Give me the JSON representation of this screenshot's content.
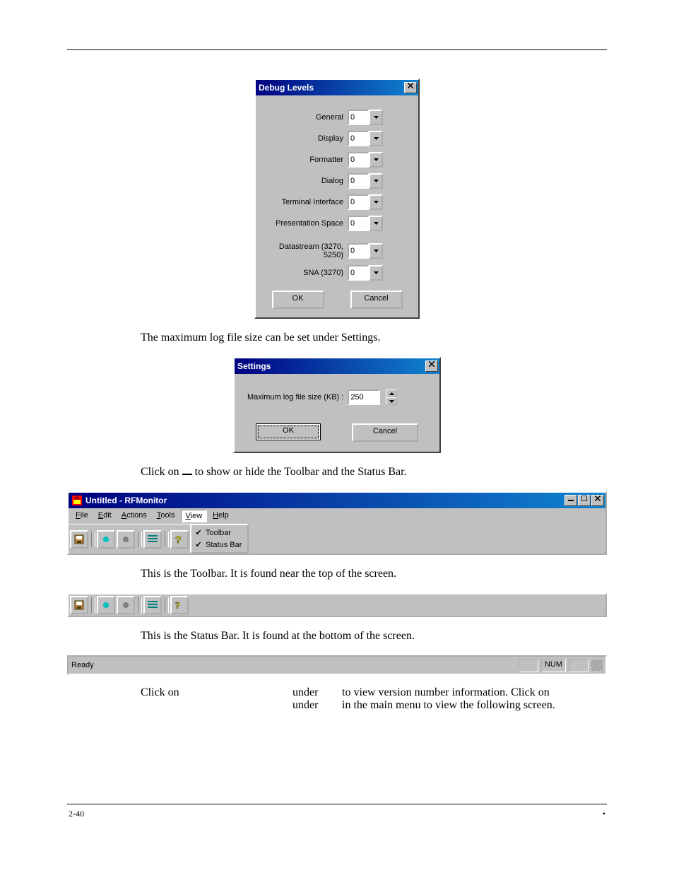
{
  "debug_dialog": {
    "title": "Debug Levels",
    "fields": [
      {
        "label": "General",
        "value": "0"
      },
      {
        "label": "Display",
        "value": "0"
      },
      {
        "label": "Formatter",
        "value": "0"
      },
      {
        "label": "Dialog",
        "value": "0"
      },
      {
        "label": "Terminal Interface",
        "value": "0"
      },
      {
        "label": "Presentation Space",
        "value": "0"
      },
      {
        "label": "Datastream (3270, 5250)",
        "value": "0"
      },
      {
        "label": "SNA (3270)",
        "value": "0"
      }
    ],
    "ok": "OK",
    "cancel": "Cancel"
  },
  "text1": "The maximum log file size can be set under Settings.",
  "settings_dialog": {
    "title": "Settings",
    "label": "Maximum log file size (KB) :",
    "value": "250",
    "ok": "OK",
    "cancel": "Cancel"
  },
  "text2_a": "Click on ",
  "text2_b": " to show or hide the Toolbar and the Status Bar.",
  "appwin": {
    "title": "Untitled - RFMonitor",
    "menus": {
      "file": "File",
      "edit": "Edit",
      "actions": "Actions",
      "tools": "Tools",
      "view": "View",
      "help": "Help"
    },
    "view_menu": {
      "toolbar": "Toolbar",
      "statusbar": "Status Bar"
    }
  },
  "text3": "This is the Toolbar. It is found near the top of the screen.",
  "text4": "This is the Status Bar. It is found at the bottom of the screen.",
  "statusbar": {
    "ready": "Ready",
    "num": "NUM"
  },
  "text5": {
    "c1": "Click on",
    "c2a": "under",
    "c2b": "under",
    "c3a": "to view version number information. Click on",
    "c3b": "in the main menu to view the following screen."
  },
  "footer": {
    "left": "2-40",
    "bullet": "•"
  }
}
